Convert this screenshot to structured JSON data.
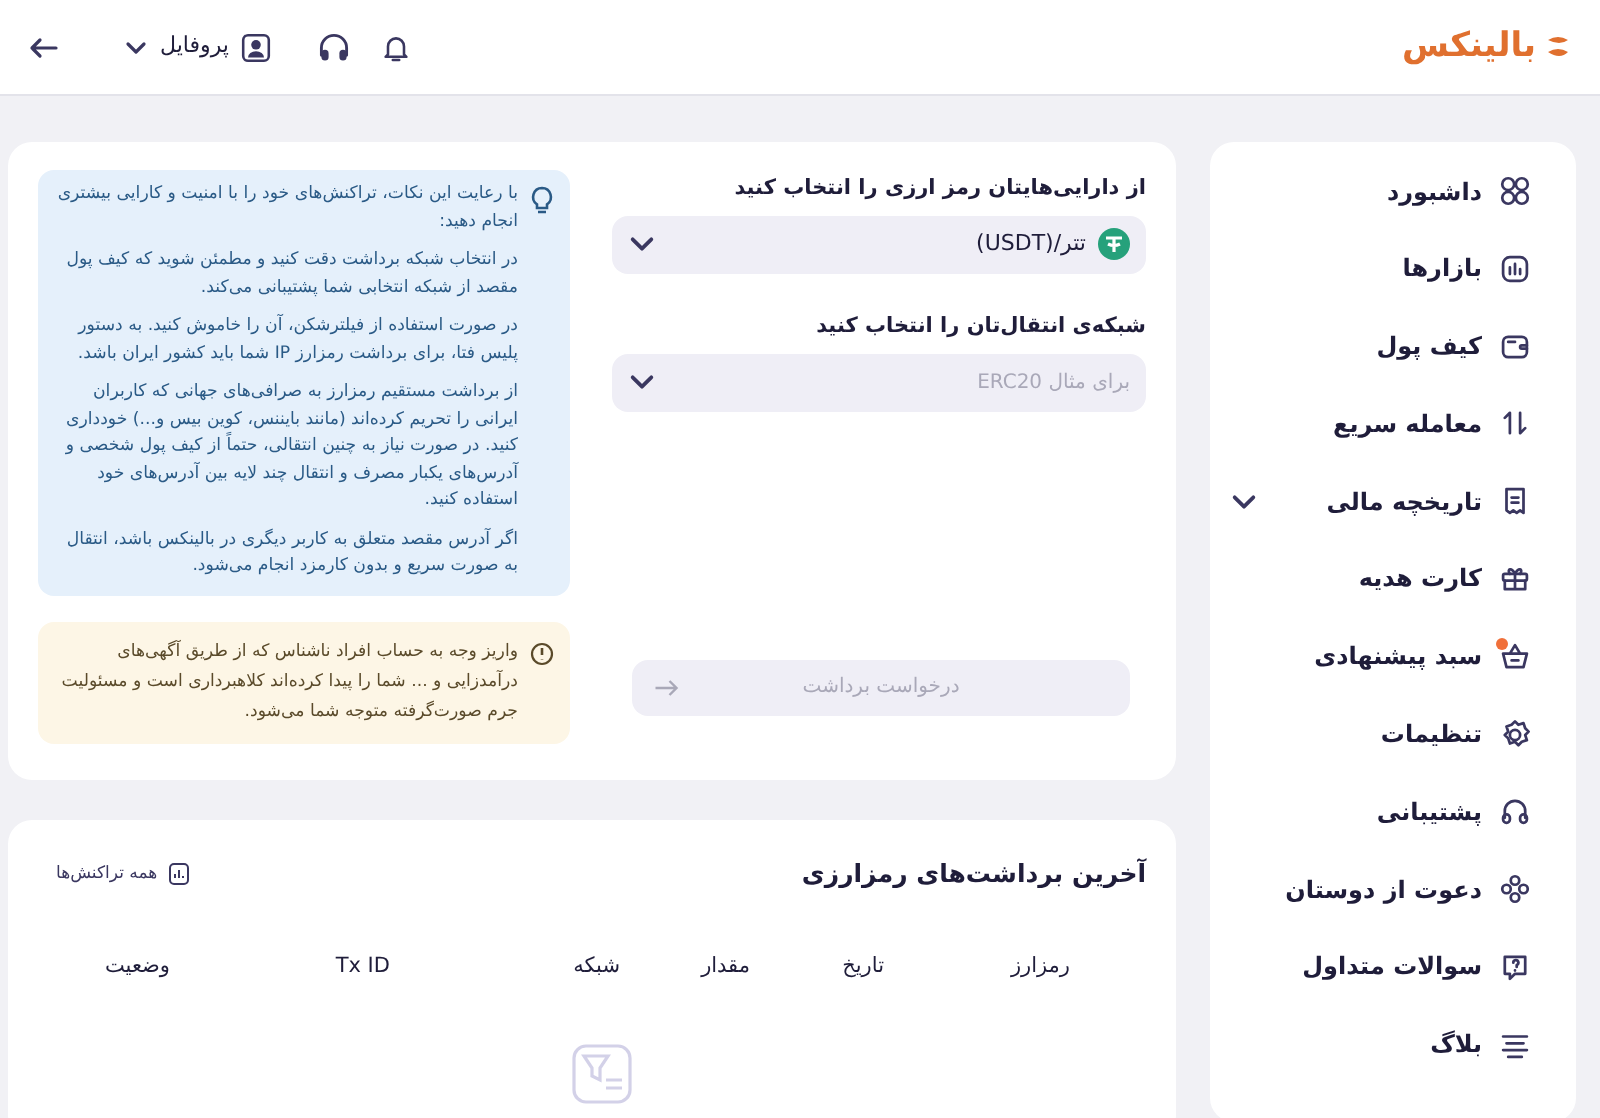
{
  "header": {
    "logo": "بالینکس",
    "profile": {
      "label": "پروفایل"
    }
  },
  "sidebar": {
    "items": [
      {
        "label": "داشبورد",
        "kind": "link",
        "has_dot": false
      },
      {
        "label": "بازارها",
        "kind": "link",
        "has_dot": false
      },
      {
        "label": "کیف پول",
        "kind": "link",
        "has_dot": false
      },
      {
        "label": "معامله سریع",
        "kind": "link",
        "has_dot": false
      },
      {
        "label": "تاریخچه مالی",
        "kind": "group",
        "expanded": false,
        "has_dot": false
      },
      {
        "label": "کارت هدیه",
        "kind": "link",
        "has_dot": false
      },
      {
        "label": "سبد پیشنهادی",
        "kind": "link",
        "has_dot": true
      },
      {
        "label": "تنظیمات",
        "kind": "link",
        "has_dot": false
      },
      {
        "label": "پشتیبانی",
        "kind": "link",
        "has_dot": false
      },
      {
        "label": "دعوت از دوستان",
        "kind": "link",
        "has_dot": false
      },
      {
        "label": "سوالات متداول",
        "kind": "link",
        "has_dot": false
      },
      {
        "label": "بلاگ",
        "kind": "link",
        "has_dot": false
      }
    ]
  },
  "withdraw_form": {
    "asset": {
      "label": "از دارایی‌هایتان رمز ارزی را انتخاب کنید",
      "value": "تتر/(USDT)"
    },
    "network": {
      "label": "شبکه‌ی انتقال‌تان را انتخاب کنید",
      "placeholder": "برای مثال ERC20"
    },
    "submit": {
      "label": "درخواست برداشت",
      "disabled": true
    }
  },
  "tips": {
    "intro": "با رعایت این نکات، تراکنش‌های خود را با امنیت و کارایی بیشتری انجام دهید:",
    "paragraphs": [
      "در انتخاب شبکه برداشت دقت کنید و مطمئن شوید که کیف پول مقصد از شبکه انتخابی شما پشتیبانی می‌کند.",
      "در صورت استفاده از فیلترشکن، آن را خاموش کنید. به دستور پلیس فتا، برای برداشت رمزارز IP شما باید کشور ایران باشد.",
      "از برداشت مستقیم رمزارز به صرافی‌های جهانی که کاربران ایرانی را تحریم کرده‌اند (مانند بایننس، کوین بیس و...) خودداری کنید. در صورت نیاز به چنین انتقالی، حتماً از کیف پول شخصی و آدرس‌های یکبار مصرف و انتقال چند لایه بین آدرس‌های خود استفاده کنید.",
      "اگر آدرس مقصد متعلق به کاربر دیگری در بالینکس باشد، انتقال به صورت سریع و بدون کارمزد انجام می‌شود."
    ]
  },
  "warning": {
    "text": "واریز وجه به حساب افراد ناشناس که از طریق آگهی‌های درآمدزایی و ... شما را پیدا کرده‌اند کلاهبرداری است و مسئولیت جرم صورت‌گرفته متوجه شما می‌شود."
  },
  "recent_withdrawals": {
    "title": "آخرین برداشت‌های رمزارزی",
    "all_link": "همه تراکنش‌ها",
    "columns": [
      "رمزارز",
      "تاریخ",
      "مقدار",
      "شبکه",
      "Tx ID",
      "وضعیت"
    ]
  }
}
